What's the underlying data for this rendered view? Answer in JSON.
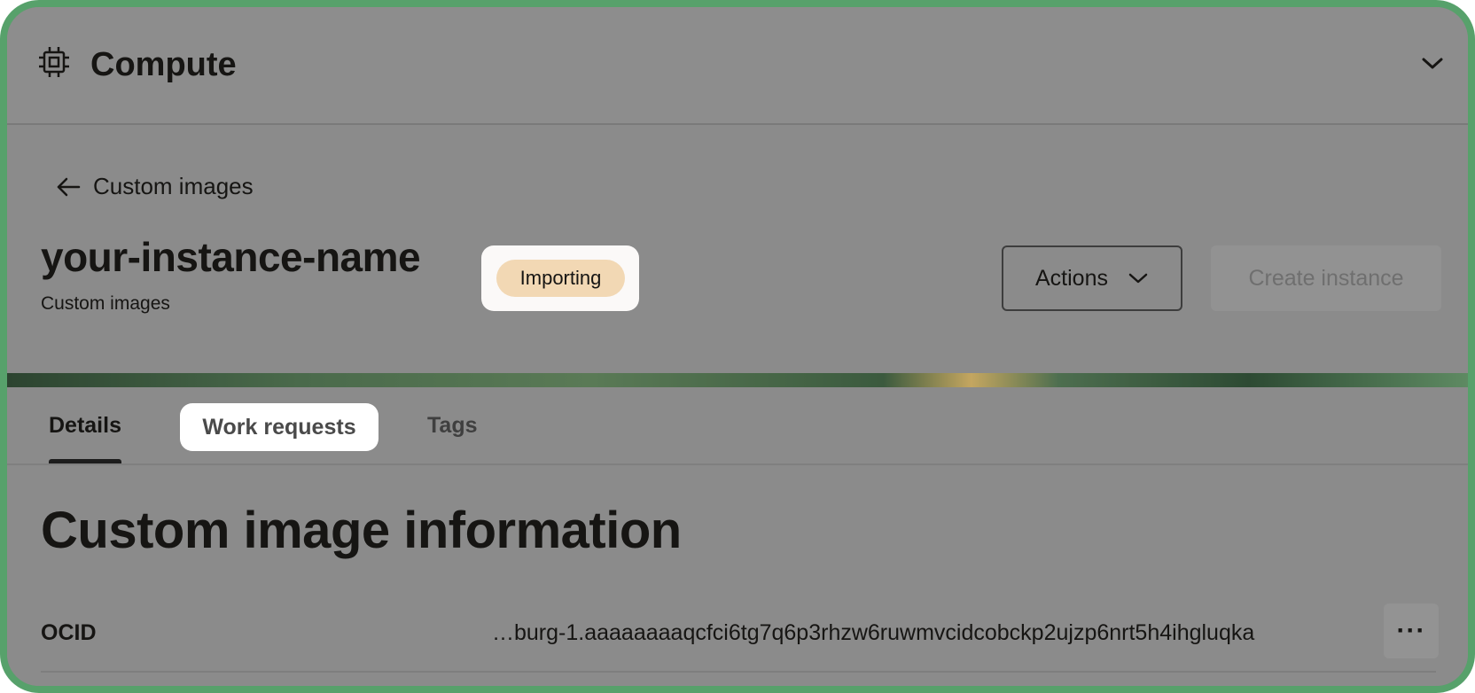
{
  "header": {
    "app_title": "Compute",
    "app_icon": "chip-icon",
    "collapse_icon": "chevron-down-icon"
  },
  "page": {
    "back_link": "Custom images",
    "back_icon": "arrow-left-icon",
    "title": "your-instance-name",
    "status_badge": "Importing",
    "subtitle": "Custom images",
    "actions_label": "Actions",
    "create_instance_label": "Create instance"
  },
  "tabs": [
    {
      "label": "Details",
      "active": true
    },
    {
      "label": "Work requests",
      "active": false
    },
    {
      "label": "Tags",
      "active": false
    }
  ],
  "content": {
    "section_title": "Custom image information",
    "ocid_label": "OCID",
    "ocid_value": "…burg-1.aaaaaaaaqcfci6tg7q6p3rhzw6ruwmvcidcobckp2ujzp6nrt5h4ihgluqka",
    "more_label": "···"
  },
  "colors": {
    "frame_border": "#57a16b",
    "badge_bg": "#f2d8b4",
    "overlay": "#8b8b8b"
  }
}
